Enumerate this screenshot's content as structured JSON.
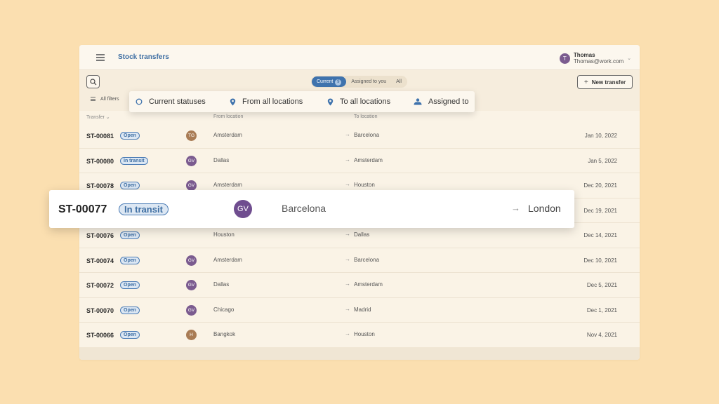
{
  "app": {
    "title": "Stock transfers",
    "user_initial": "T",
    "user_name": "Thomas",
    "user_email": "Thomas@work.com"
  },
  "toolbar": {
    "tabs": [
      {
        "label": "Current",
        "count": "9",
        "active": true
      },
      {
        "label": "Assigned to you",
        "active": false
      },
      {
        "label": "All",
        "active": false
      }
    ],
    "new_transfer_label": "New transfer",
    "all_filters_label": "All filters"
  },
  "filters": [
    {
      "label": "Current statuses",
      "icon": "circle-icon"
    },
    {
      "label": "From all locations",
      "icon": "location-pin-icon"
    },
    {
      "label": "To all locations",
      "icon": "location-pin-icon"
    },
    {
      "label": "Assigned to",
      "icon": "people-icon"
    }
  ],
  "columns": {
    "transfer": "Transfer",
    "from": "From location",
    "to": "To location"
  },
  "colors": {
    "background": "#fbdfb0",
    "accent": "#3f73ad",
    "avatar_purple": "#7b5b8f",
    "avatar_brown": "#a97c55"
  },
  "rows": [
    {
      "id": "ST-00081",
      "status": "Open",
      "initials": "TG",
      "avatar_color": "#a97c55",
      "from": "Amsterdam",
      "to": "Barcelona",
      "date": "Jan 10, 2022"
    },
    {
      "id": "ST-00080",
      "status": "In transit",
      "initials": "GV",
      "avatar_color": "#7b5b8f",
      "from": "Dallas",
      "to": "Amsterdam",
      "date": "Jan 5, 2022"
    },
    {
      "id": "ST-00078",
      "status": "Open",
      "initials": "GV",
      "avatar_color": "#7b5b8f",
      "from": "Amsterdam",
      "to": "Houston",
      "date": "Dec 20, 2021"
    },
    {
      "id": "ST-00077",
      "status": "In transit",
      "initials": "GV",
      "avatar_color": "#7b5b8f",
      "from": "Barcelona",
      "to": "London",
      "date": "Dec 19, 2021"
    },
    {
      "id": "ST-00076",
      "status": "Open",
      "initials": "",
      "avatar_color": "",
      "from": "Houston",
      "to": "Dallas",
      "date": "Dec 14, 2021"
    },
    {
      "id": "ST-00074",
      "status": "Open",
      "initials": "GV",
      "avatar_color": "#7b5b8f",
      "from": "Amsterdam",
      "to": "Barcelona",
      "date": "Dec 10, 2021"
    },
    {
      "id": "ST-00072",
      "status": "Open",
      "initials": "GV",
      "avatar_color": "#7b5b8f",
      "from": "Dallas",
      "to": "Amsterdam",
      "date": "Dec 5, 2021"
    },
    {
      "id": "ST-00070",
      "status": "Open",
      "initials": "GV",
      "avatar_color": "#7b5b8f",
      "from": "Chicago",
      "to": "Madrid",
      "date": "Dec 1, 2021"
    },
    {
      "id": "ST-00066",
      "status": "Open",
      "initials": "H",
      "avatar_color": "#a97c55",
      "from": "Bangkok",
      "to": "Houston",
      "date": "Nov 4, 2021"
    }
  ],
  "highlighted": {
    "id": "ST-00077",
    "status": "In transit",
    "initials": "GV",
    "from": "Barcelona",
    "to": "London"
  }
}
